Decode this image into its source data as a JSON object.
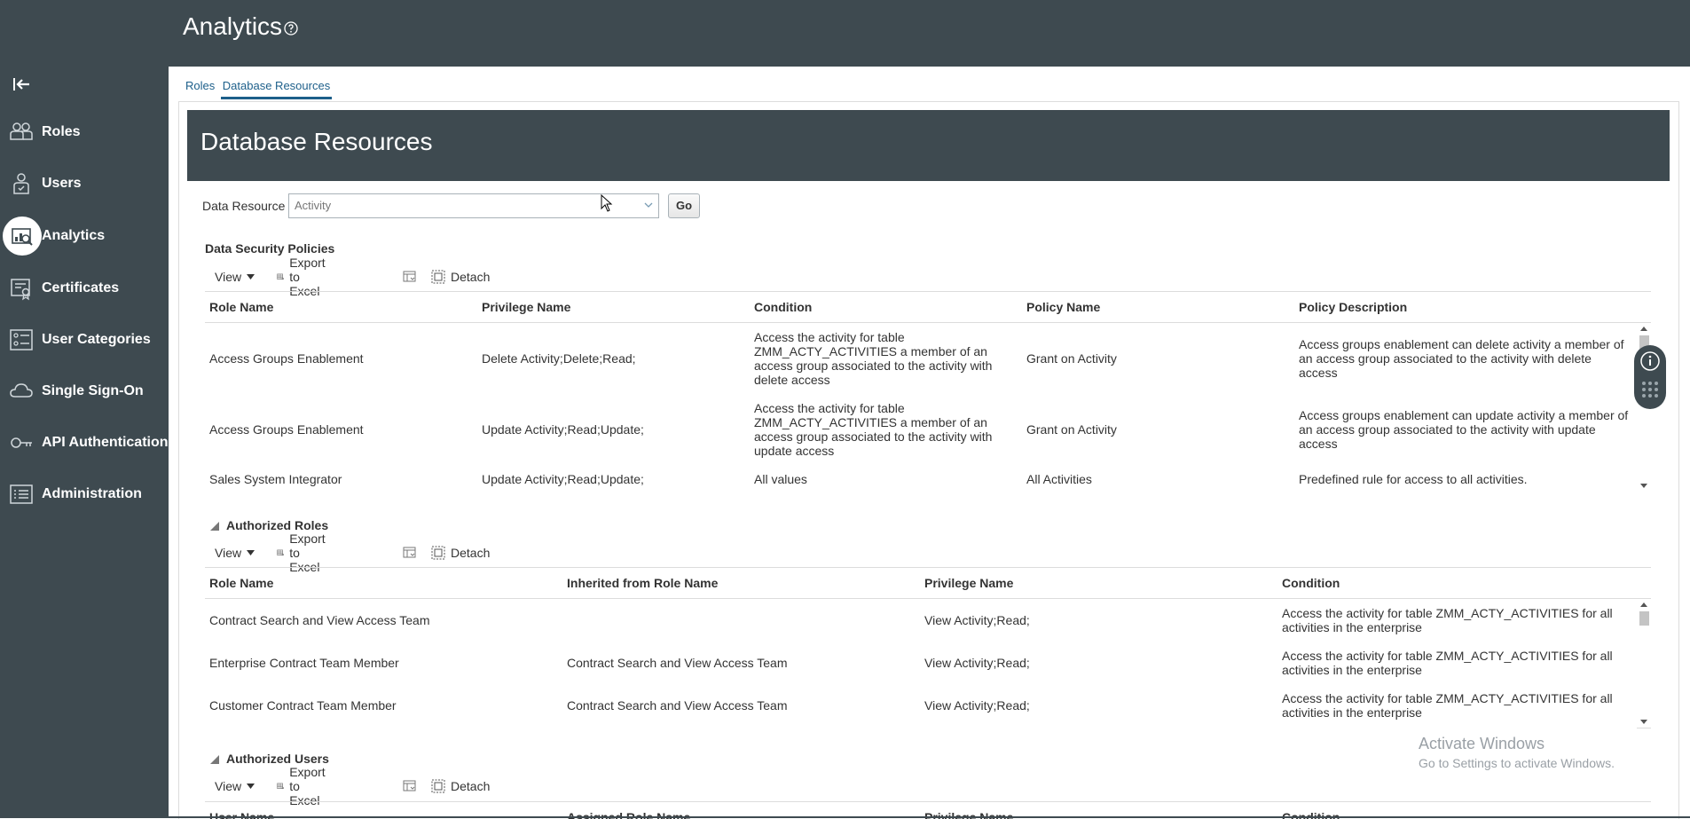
{
  "app": {
    "title": "Analytics"
  },
  "sidebar": {
    "items": [
      {
        "label": "Roles",
        "icon": "roles-icon"
      },
      {
        "label": "Users",
        "icon": "users-icon"
      },
      {
        "label": "Analytics",
        "icon": "analytics-icon",
        "active": true
      },
      {
        "label": "Certificates",
        "icon": "certificates-icon"
      },
      {
        "label": "User Categories",
        "icon": "user-categories-icon"
      },
      {
        "label": "Single Sign-On",
        "icon": "cloud-icon"
      },
      {
        "label": "API Authentication",
        "icon": "key-icon"
      },
      {
        "label": "Administration",
        "icon": "administration-icon"
      }
    ]
  },
  "tabs": [
    {
      "label": "Roles"
    },
    {
      "label": "Database Resources",
      "active": true
    }
  ],
  "page": {
    "title": "Database Resources"
  },
  "data_resource": {
    "label": "Data Resource",
    "value": "Activity",
    "go_label": "Go"
  },
  "toolbar": {
    "view": "View",
    "export": "Export to Excel",
    "detach": "Detach"
  },
  "sections": {
    "dsp": {
      "title": "Data Security Policies",
      "columns": [
        "Role Name",
        "Privilege Name",
        "Condition",
        "Policy Name",
        "Policy Description"
      ],
      "rows": [
        {
          "role": "Access Groups Enablement",
          "privilege": "Delete Activity;Delete;Read;",
          "condition": [
            "Access the activity for table",
            "ZMM_ACTY_ACTIVITIES a member of an",
            "access group associated to the activity with",
            "delete access"
          ],
          "policy": "Grant on Activity",
          "description": [
            "Access groups enablement can delete activity a member of",
            "an access group associated to the activity with delete",
            "access"
          ]
        },
        {
          "role": "Access Groups Enablement",
          "privilege": "Update Activity;Read;Update;",
          "condition": [
            "Access the activity for table",
            "ZMM_ACTY_ACTIVITIES a member of an",
            "access group associated to the activity with",
            "update access"
          ],
          "policy": "Grant on Activity",
          "description": [
            "Access groups enablement can update activity a member of",
            "an access group associated to the activity with update",
            "access"
          ]
        },
        {
          "role": "Sales System Integrator",
          "privilege": "Update Activity;Read;Update;",
          "condition": [
            "All values"
          ],
          "policy": "All Activities",
          "description": [
            "Predefined rule for access to all activities."
          ]
        }
      ]
    },
    "roles": {
      "title": "Authorized Roles",
      "columns": [
        "Role Name",
        "Inherited from Role Name",
        "Privilege Name",
        "Condition"
      ],
      "rows": [
        {
          "role": "Contract Search and View Access Team",
          "inherited": "",
          "privilege": "View Activity;Read;",
          "condition": [
            "Access the activity for table ZMM_ACTY_ACTIVITIES for all",
            "activities in the enterprise"
          ]
        },
        {
          "role": "Enterprise Contract Team Member",
          "inherited": "Contract Search and View Access Team",
          "privilege": "View Activity;Read;",
          "condition": [
            "Access the activity for table ZMM_ACTY_ACTIVITIES for all",
            "activities in the enterprise"
          ]
        },
        {
          "role": "Customer Contract Team Member",
          "inherited": "Contract Search and View Access Team",
          "privilege": "View Activity;Read;",
          "condition": [
            "Access the activity for table ZMM_ACTY_ACTIVITIES for all",
            "activities in the enterprise"
          ]
        }
      ]
    },
    "users": {
      "title": "Authorized Users",
      "columns": [
        "User Name",
        "Assigned Role Name",
        "Privilege Name",
        "Condition"
      ]
    }
  },
  "watermark": {
    "line1": "Activate Windows",
    "line2": "Go to Settings to activate Windows."
  }
}
